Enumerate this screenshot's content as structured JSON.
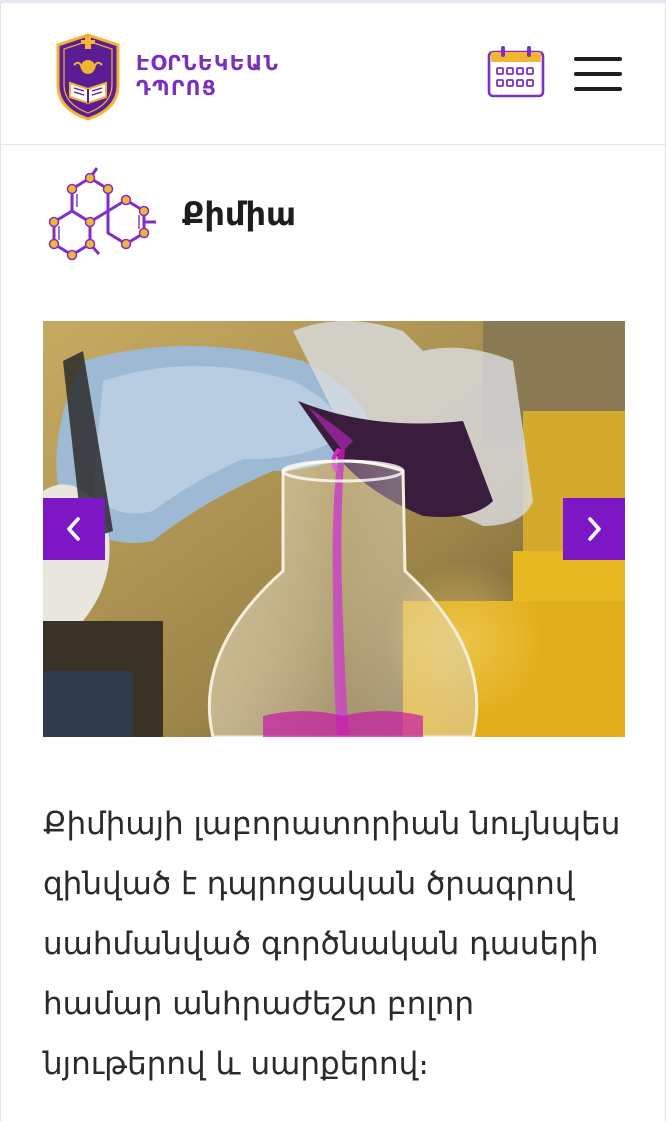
{
  "header": {
    "logo": {
      "line1": "ԷՕՐՆԵԿԵԱՆ",
      "line2": "ԴՊՐՈՑ",
      "emblem_icon": "school-shield-emblem"
    },
    "calendar_icon": "calendar-icon",
    "menu_icon": "hamburger-menu-icon"
  },
  "subject": {
    "icon": "molecule-icon",
    "title": "Քիմիա"
  },
  "slider": {
    "image": "lab-pouring-photo",
    "prev_icon": "chevron-left-icon",
    "next_icon": "chevron-right-icon"
  },
  "content": {
    "description": "Քիմիայի լաբորատորիան նույնպես զինված է դպրոցական ծրագրով սահմանված գործնական դասերի համար անհրաժեշտ բոլոր նյութերով և սարքերով։"
  },
  "colors": {
    "brand_purple": "#7b2fbf",
    "arrow_purple": "#7d16c4",
    "gold": "#f2b632"
  }
}
